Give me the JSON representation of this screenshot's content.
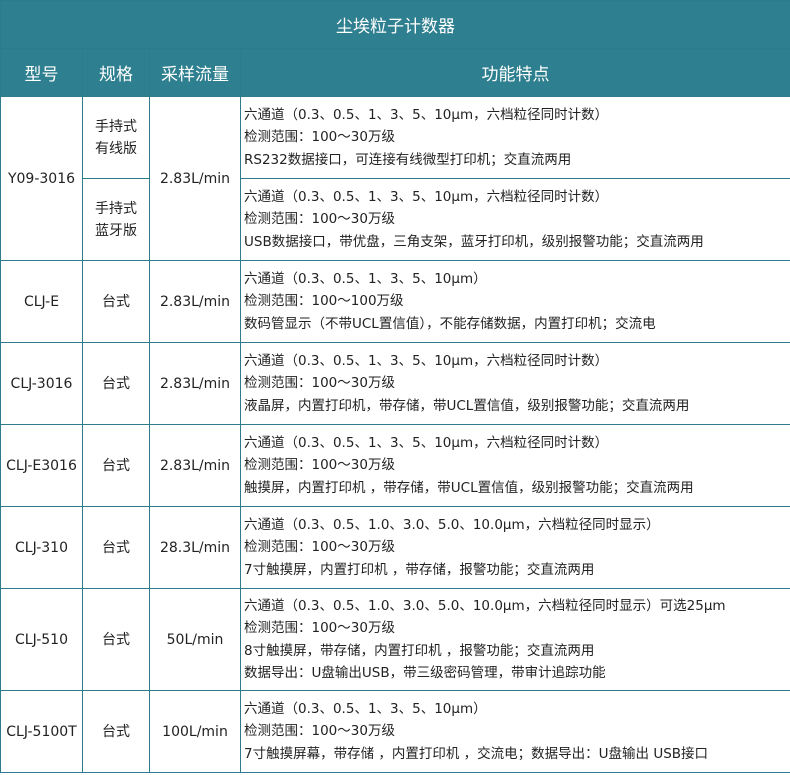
{
  "title": "尘埃粒子计数器",
  "headers": {
    "model": "型号",
    "spec": "规格",
    "flow": "采样流量",
    "features": "功能特点"
  },
  "rows": [
    {
      "model": "Y09-3016",
      "flow": "2.83L/min",
      "subrows": [
        {
          "spec_lines": [
            "手持式",
            "有线版"
          ],
          "features": [
            "六通道（0.3、0.5、1、3、5、10μm，六档粒径同时计数）",
            "检测范围：100～30万级",
            "RS232数据接口，可连接有线微型打印机；交直流两用"
          ]
        },
        {
          "spec_lines": [
            "手持式",
            "蓝牙版"
          ],
          "features": [
            "六通道（0.3、0.5、1、3、5、10μm，六档粒径同时计数）",
            "检测范围：100～30万级",
            "USB数据接口，带优盘，三角支架，蓝牙打印机，级别报警功能；交直流两用"
          ]
        }
      ]
    },
    {
      "model": "CLJ-E",
      "spec": "台式",
      "flow": "2.83L/min",
      "features": [
        "六通道（0.3、0.5、1、3、5、10μm）",
        "检测范围：100～100万级",
        "数码管显示（不带UCL置信值），不能存储数据，内置打印机；交流电"
      ]
    },
    {
      "model": "CLJ-3016",
      "spec": "台式",
      "flow": "2.83L/min",
      "features": [
        "六通道（0.3、0.5、1、3、5、10μm，六档粒径同时计数）",
        "检测范围：100～30万级",
        "液晶屏，内置打印机，带存储，带UCL置信值，级别报警功能；交直流两用"
      ]
    },
    {
      "model": "CLJ-E3016",
      "spec": "台式",
      "flow": "2.83L/min",
      "features": [
        "六通道（0.3、0.5、1、3、5、10μm，六档粒径同时计数）",
        "检测范围：100～30万级",
        "触摸屏，内置打印机 ，带存储，带UCL置信值，级别报警功能；交直流两用"
      ]
    },
    {
      "model": "CLJ-310",
      "spec": "台式",
      "flow": "28.3L/min",
      "features": [
        "六通道（0.3、0.5、1.0、3.0、5.0、10.0μm，六档粒径同时显示）",
        "检测范围：100～30万级",
        "7寸触摸屏，内置打印机 ，带存储，报警功能；交直流两用"
      ]
    },
    {
      "model": "CLJ-510",
      "spec": "台式",
      "flow": "50L/min",
      "features": [
        "六通道（0.3、0.5、1.0、3.0、5.0、10.0μm，六档粒径同时显示）可选25μm",
        "检测范围：100～30万级",
        "8寸触摸屏，带存储，内置打印机 ，报警功能；交直流两用",
        "数据导出：U盘输出USB，带三级密码管理，带审计追踪功能"
      ]
    },
    {
      "model": "CLJ-5100T",
      "spec": "台式",
      "flow": "100L/min",
      "features": [
        "六通道（0.3、0.5、1、3、5、10μm）",
        "检测范围：100～30万级",
        "7寸触摸屏幕，带存储 ，内置打印机 ，交流电；数据导出：U盘输出 USB接口"
      ]
    }
  ]
}
